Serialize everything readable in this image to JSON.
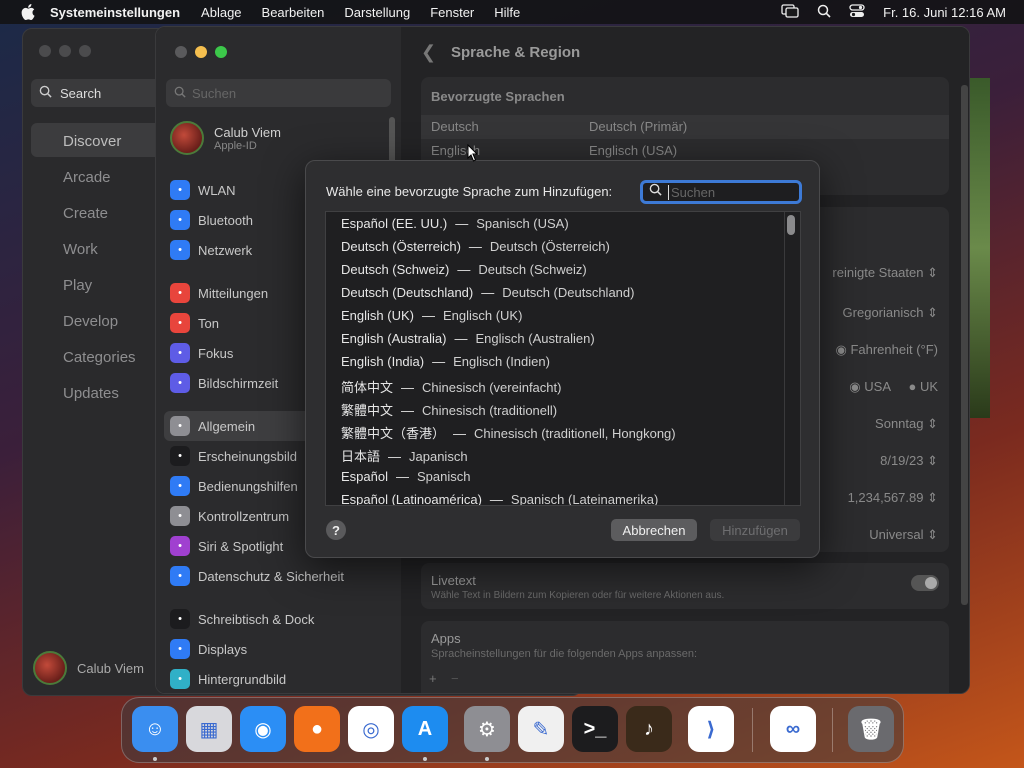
{
  "menubar": {
    "app": "Systemeinstellungen",
    "items": [
      "Ablage",
      "Bearbeiten",
      "Darstellung",
      "Fenster",
      "Hilfe"
    ],
    "clock": "Fr. 16. Juni  12:16 AM"
  },
  "appstore": {
    "search_label": "Search",
    "items": [
      "Discover",
      "Arcade",
      "Create",
      "Work",
      "Play",
      "Develop",
      "Categories",
      "Updates"
    ],
    "user": "Calub Viem"
  },
  "sidebar": {
    "search_placeholder": "Suchen",
    "user_name": "Calub Viem",
    "user_sub": "Apple-ID",
    "items": [
      {
        "label": "WLAN",
        "icon": "wifi-icon",
        "color": "#2f7bf5"
      },
      {
        "label": "Bluetooth",
        "icon": "bluetooth-icon",
        "color": "#2f7bf5"
      },
      {
        "label": "Netzwerk",
        "icon": "globe-icon",
        "color": "#2f7bf5"
      },
      {
        "label": "Mitteilungen",
        "icon": "bell-icon",
        "color": "#e8453c"
      },
      {
        "label": "Ton",
        "icon": "speaker-icon",
        "color": "#e8453c"
      },
      {
        "label": "Fokus",
        "icon": "moon-icon",
        "color": "#5e5ce6"
      },
      {
        "label": "Bildschirmzeit",
        "icon": "hourglass-icon",
        "color": "#5e5ce6"
      },
      {
        "label": "Allgemein",
        "icon": "gear-icon",
        "color": "#8e8e93"
      },
      {
        "label": "Erscheinungsbild",
        "icon": "appearance-icon",
        "color": "#1c1c1e"
      },
      {
        "label": "Bedienungshilfen",
        "icon": "accessibility-icon",
        "color": "#2f7bf5"
      },
      {
        "label": "Kontrollzentrum",
        "icon": "control-center-icon",
        "color": "#8e8e93"
      },
      {
        "label": "Siri & Spotlight",
        "icon": "siri-icon",
        "color": "#a040d0"
      },
      {
        "label": "Datenschutz & Sicherheit",
        "icon": "hand-icon",
        "color": "#2f7bf5"
      },
      {
        "label": "Schreibtisch & Dock",
        "icon": "dock-icon",
        "color": "#1c1c1e"
      },
      {
        "label": "Displays",
        "icon": "display-icon",
        "color": "#2f7bf5"
      },
      {
        "label": "Hintergrundbild",
        "icon": "wallpaper-icon",
        "color": "#30b0c7"
      }
    ]
  },
  "content": {
    "title": "Sprache & Region",
    "preferred_header": "Bevorzugte Sprachen",
    "preferred": [
      {
        "name": "Deutsch",
        "detail": "Deutsch (Primär)"
      },
      {
        "name": "Englisch",
        "detail": "Englisch (USA)"
      }
    ],
    "region_value": "reinigte Staaten",
    "calendar_value": "Gregorianisch",
    "temp_value": "Fahrenheit (°F)",
    "measure_usa": "USA",
    "measure_uk": "UK",
    "first_day": "Sonntag",
    "date_format": "8/19/23",
    "number_format": "1,234,567.89",
    "sort_value": "Universal",
    "livetext_title": "Livetext",
    "livetext_desc": "Wähle Text in Bildern zum Kopieren oder für weitere Aktionen aus.",
    "apps_title": "Apps",
    "apps_desc": "Spracheinstellungen für die folgenden Apps anpassen:",
    "plus": "+",
    "minus": "−"
  },
  "modal": {
    "prompt": "Wähle eine bevorzugte Sprache zum Hinzufügen:",
    "search_placeholder": "Suchen",
    "languages": [
      {
        "native": "Español (EE. UU.)",
        "translated": "Spanisch (USA)"
      },
      {
        "native": "Deutsch (Österreich)",
        "translated": "Deutsch (Österreich)"
      },
      {
        "native": "Deutsch (Schweiz)",
        "translated": "Deutsch (Schweiz)"
      },
      {
        "native": "Deutsch (Deutschland)",
        "translated": "Deutsch (Deutschland)"
      },
      {
        "native": "English (UK)",
        "translated": "Englisch (UK)"
      },
      {
        "native": "English (Australia)",
        "translated": "Englisch (Australien)"
      },
      {
        "native": "English (India)",
        "translated": "Englisch (Indien)"
      },
      {
        "native": "简体中文",
        "translated": "Chinesisch (vereinfacht)"
      },
      {
        "native": "繁體中文",
        "translated": "Chinesisch (traditionell)"
      },
      {
        "native": "繁體中文（香港）",
        "translated": "Chinesisch (traditionell, Hongkong)"
      },
      {
        "native": "日本語",
        "translated": "Japanisch"
      },
      {
        "native": "Español",
        "translated": "Spanisch"
      },
      {
        "native": "Español (Latinoamérica)",
        "translated": "Spanisch (Lateinamerika)"
      }
    ],
    "help": "?",
    "cancel": "Abbrechen",
    "add": "Hinzufügen"
  },
  "dock": {
    "apps": [
      {
        "name": "finder-icon",
        "color": "#3a8ef0",
        "glyph": "☺",
        "running": true
      },
      {
        "name": "launchpad-icon",
        "color": "#d8d8dc",
        "glyph": "▦",
        "running": false
      },
      {
        "name": "safari-icon",
        "color": "#2b8ef5",
        "glyph": "◉",
        "running": false
      },
      {
        "name": "firefox-icon",
        "color": "#f2701a",
        "glyph": "●",
        "running": false
      },
      {
        "name": "chrome-icon",
        "color": "#ffffff",
        "glyph": "◎",
        "running": false
      },
      {
        "name": "app-store-icon",
        "color": "#1d8cf0",
        "glyph": "A",
        "running": true
      },
      {
        "name": "system-settings-icon",
        "color": "#8e8e93",
        "glyph": "⚙",
        "running": true
      },
      {
        "name": "textedit-icon",
        "color": "#f0f0f0",
        "glyph": "✎",
        "running": false
      },
      {
        "name": "terminal-icon",
        "color": "#1c1c1e",
        "glyph": ">_",
        "running": false
      },
      {
        "name": "garageband-icon",
        "color": "#3a2a1a",
        "glyph": "♪",
        "running": false
      },
      {
        "name": "vscode-icon",
        "color": "#ffffff",
        "glyph": "⟩",
        "running": false
      },
      {
        "name": "visual-studio-icon",
        "color": "#ffffff",
        "glyph": "∞",
        "running": false
      },
      {
        "name": "trash-icon",
        "color": "#6a6a6e",
        "glyph": "🗑",
        "running": false
      }
    ]
  }
}
